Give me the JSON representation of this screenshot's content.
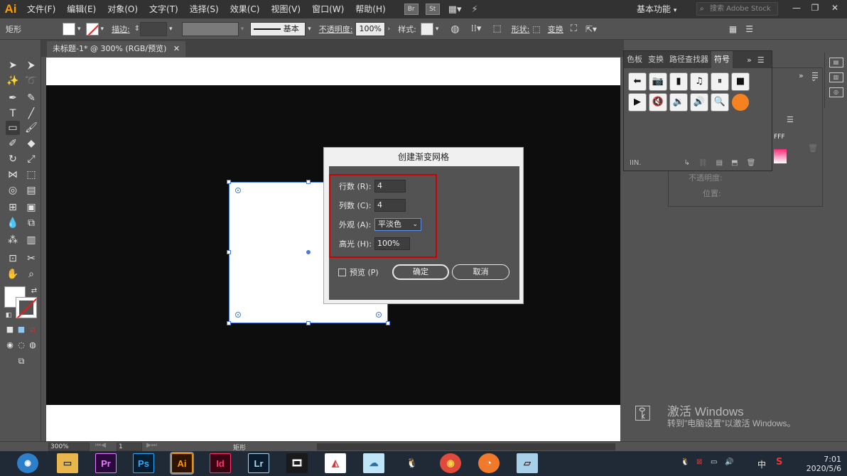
{
  "app": {
    "logo": "Ai",
    "menu": [
      "文件(F)",
      "编辑(E)",
      "对象(O)",
      "文字(T)",
      "选择(S)",
      "效果(C)",
      "视图(V)",
      "窗口(W)",
      "帮助(H)"
    ],
    "bridge_icon": "Br",
    "stock_icon": "St",
    "workspace": "基本功能",
    "search_placeholder": "搜索 Adobe Stock",
    "window_controls": [
      "—",
      "❐",
      "✕"
    ]
  },
  "control_bar": {
    "selection_label": "矩形",
    "stroke_label": "描边:",
    "stroke_style": "基本",
    "opacity_label": "不透明度:",
    "opacity_value": "100%",
    "style_label": "样式:",
    "shape_label": "形状:",
    "transform_label": "变换"
  },
  "document": {
    "tab_title": "未标题-1* @ 300% (RGB/预览)"
  },
  "dialog": {
    "title": "创建渐变网格",
    "rows_label": "行数 (R):",
    "rows_value": "4",
    "cols_label": "列数 (C):",
    "cols_value": "4",
    "appearance_label": "外观 (A):",
    "appearance_value": "平淡色",
    "highlight_label": "高光 (H):",
    "highlight_value": "100%",
    "preview_label": "预览 (P)",
    "ok_label": "确定",
    "cancel_label": "取消"
  },
  "symbols_panel": {
    "tabs": [
      "色板",
      "变换",
      "路径查找器",
      "符号"
    ],
    "active_tab": "符号",
    "symbols": [
      "back-arrow",
      "camera",
      "film",
      "music-note",
      "pause",
      "stop",
      "play",
      "mute",
      "volume-low",
      "volume-high",
      "magnifier",
      "orange-circle"
    ],
    "footer_library": "IIN."
  },
  "back_panel": {
    "swatch_code": "FFF",
    "opacity_label": "不透明度:",
    "position_label": "位置:"
  },
  "status_bar": {
    "zoom": "300%",
    "artboard_index": "1",
    "tool_name": "矩形"
  },
  "watermark": {
    "line1": "激活 Windows",
    "line2": "转到\"电脑设置\"以激活 Windows。"
  },
  "taskbar": {
    "apps": [
      {
        "name": "Pr",
        "color": "#2a0a3a",
        "fg": "#e77bff"
      },
      {
        "name": "Ps",
        "color": "#061e30",
        "fg": "#31a8ff"
      },
      {
        "name": "Ai",
        "color": "#2e1300",
        "fg": "#ff9a00"
      },
      {
        "name": "Id",
        "color": "#3a0415",
        "fg": "#ff3366"
      },
      {
        "name": "Lr",
        "color": "#0a1c2e",
        "fg": "#add5ec"
      }
    ],
    "ime": "中",
    "time": "7:01",
    "date": "2020/5/6"
  },
  "colors": {
    "ui_gray": "#535353",
    "highlight_red": "#d00000",
    "selection_blue": "#4a7bdc",
    "symbol_orange": "#f58220"
  }
}
